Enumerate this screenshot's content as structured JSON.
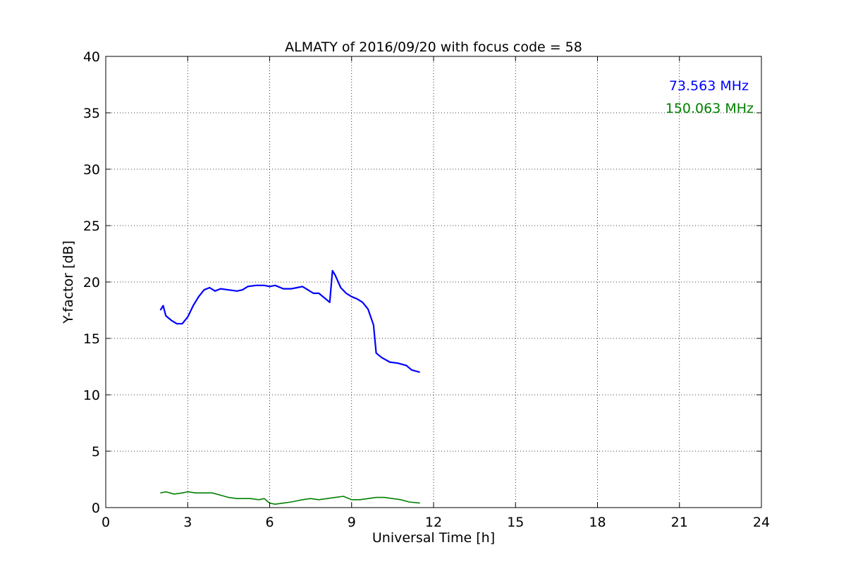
{
  "chart_data": {
    "type": "line",
    "title": "ALMATY of 2016/09/20 with focus code = 58",
    "xlabel": "Universal Time [h]",
    "ylabel": "Y-factor [dB]",
    "xlim": [
      0,
      24
    ],
    "ylim": [
      0,
      40
    ],
    "xticks": [
      0,
      3,
      6,
      9,
      12,
      15,
      18,
      21,
      24
    ],
    "yticks": [
      0,
      5,
      10,
      15,
      20,
      25,
      30,
      35,
      40
    ],
    "grid": true,
    "legend_position": "top-right",
    "series": [
      {
        "name": "73.563 MHz",
        "color": "#0000ff",
        "points": [
          [
            2.0,
            17.5
          ],
          [
            2.1,
            17.9
          ],
          [
            2.2,
            17.0
          ],
          [
            2.4,
            16.6
          ],
          [
            2.6,
            16.3
          ],
          [
            2.8,
            16.3
          ],
          [
            3.0,
            16.9
          ],
          [
            3.2,
            17.9
          ],
          [
            3.4,
            18.7
          ],
          [
            3.6,
            19.3
          ],
          [
            3.8,
            19.5
          ],
          [
            4.0,
            19.2
          ],
          [
            4.2,
            19.4
          ],
          [
            4.5,
            19.3
          ],
          [
            4.8,
            19.2
          ],
          [
            5.0,
            19.3
          ],
          [
            5.2,
            19.6
          ],
          [
            5.5,
            19.7
          ],
          [
            5.8,
            19.7
          ],
          [
            6.0,
            19.6
          ],
          [
            6.2,
            19.7
          ],
          [
            6.5,
            19.4
          ],
          [
            6.8,
            19.4
          ],
          [
            7.0,
            19.5
          ],
          [
            7.2,
            19.6
          ],
          [
            7.4,
            19.3
          ],
          [
            7.6,
            19.0
          ],
          [
            7.8,
            19.0
          ],
          [
            8.0,
            18.6
          ],
          [
            8.2,
            18.2
          ],
          [
            8.3,
            21.0
          ],
          [
            8.4,
            20.6
          ],
          [
            8.6,
            19.5
          ],
          [
            8.8,
            19.0
          ],
          [
            9.0,
            18.7
          ],
          [
            9.2,
            18.5
          ],
          [
            9.4,
            18.2
          ],
          [
            9.6,
            17.6
          ],
          [
            9.8,
            16.2
          ],
          [
            9.9,
            13.7
          ],
          [
            10.1,
            13.3
          ],
          [
            10.4,
            12.9
          ],
          [
            10.7,
            12.8
          ],
          [
            11.0,
            12.6
          ],
          [
            11.2,
            12.2
          ],
          [
            11.5,
            12.0
          ]
        ]
      },
      {
        "name": "150.063 MHz",
        "color": "#008000",
        "points": [
          [
            2.0,
            1.3
          ],
          [
            2.2,
            1.4
          ],
          [
            2.5,
            1.2
          ],
          [
            2.8,
            1.3
          ],
          [
            3.0,
            1.4
          ],
          [
            3.3,
            1.3
          ],
          [
            3.6,
            1.3
          ],
          [
            3.9,
            1.3
          ],
          [
            4.2,
            1.1
          ],
          [
            4.5,
            0.9
          ],
          [
            4.8,
            0.8
          ],
          [
            5.0,
            0.8
          ],
          [
            5.3,
            0.8
          ],
          [
            5.6,
            0.7
          ],
          [
            5.8,
            0.8
          ],
          [
            6.0,
            0.4
          ],
          [
            6.2,
            0.3
          ],
          [
            6.5,
            0.4
          ],
          [
            6.8,
            0.5
          ],
          [
            7.0,
            0.6
          ],
          [
            7.2,
            0.7
          ],
          [
            7.5,
            0.8
          ],
          [
            7.8,
            0.7
          ],
          [
            8.1,
            0.8
          ],
          [
            8.4,
            0.9
          ],
          [
            8.7,
            1.0
          ],
          [
            9.0,
            0.7
          ],
          [
            9.3,
            0.7
          ],
          [
            9.6,
            0.8
          ],
          [
            9.9,
            0.9
          ],
          [
            10.2,
            0.9
          ],
          [
            10.5,
            0.8
          ],
          [
            10.8,
            0.7
          ],
          [
            11.1,
            0.5
          ],
          [
            11.5,
            0.4
          ]
        ]
      }
    ]
  }
}
